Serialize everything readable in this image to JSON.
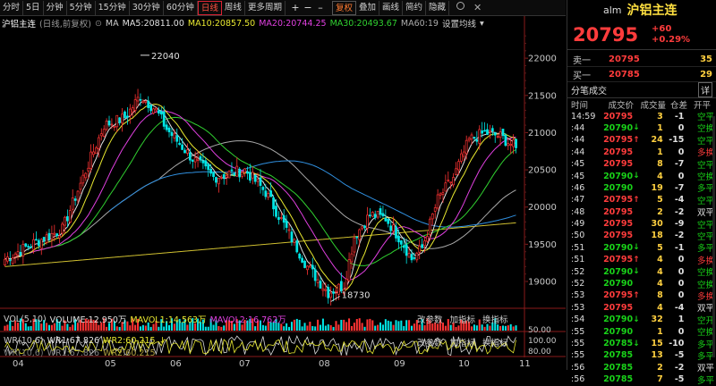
{
  "toolbar": {
    "periods": [
      "分时",
      "5日",
      "分钟",
      "5分钟",
      "15分钟",
      "30分钟",
      "60分钟",
      "日线",
      "周线",
      "更多周期"
    ],
    "active_period": "日线",
    "symbols": [
      "+",
      "−",
      "–"
    ],
    "right_btns": [
      "复权",
      "叠加",
      "画线",
      "简约",
      "隐藏"
    ],
    "active_right": "复权"
  },
  "info": {
    "name": "沪铝主连",
    "mode": "(日线,前复权)",
    "ma_label": "MA",
    "ma5": "MA5:20811.00",
    "ma10": "MA10:20857.50",
    "ma20": "MA20:20744.25",
    "ma30": "MA30:20493.67",
    "ma60": "MA60:19",
    "setting": "设置均线"
  },
  "chart_data": {
    "type": "candlestick",
    "ylim": [
      18700,
      22350
    ],
    "y_ticks": [
      22000,
      21500,
      21000,
      20500,
      20000,
      19500,
      19000
    ],
    "x_labels": [
      "04",
      "05",
      "06",
      "07",
      "08",
      "09",
      "10",
      "11"
    ],
    "high_label": "22040",
    "low_label": "18730",
    "colors": {
      "up": "#ff3333",
      "down": "#00e5e5",
      "ma5": "#e0e0e0",
      "ma10": "#e8e830",
      "ma20": "#e040e0",
      "ma30": "#30d030",
      "ma60": "#aaaaaa",
      "ma120": "#3090e0",
      "ma250": "#d0c030"
    }
  },
  "vol": {
    "label": "VOL(5,10)",
    "volume": "VOLUME:12.950万",
    "mavol1": "MAVOL1:14.563万",
    "mavol2": "MAVOL2:16.762万",
    "params": "改参数",
    "add": "加指标",
    "swap": "换指标",
    "axis": "50.00"
  },
  "wr1": {
    "label": "WR(10,6)",
    "wr1": "WR1:67.826",
    "wr2": "WR2:60.215",
    "axis_top": "100.00",
    "axis_bottom": "80.00"
  },
  "wr2": {
    "label": "WR(10,6)",
    "wr1": "WR1:67.826",
    "wr2": "WR2:60.215"
  },
  "panel": {
    "code": "alm",
    "name": "沪铝主连",
    "price": "20795",
    "change": "+60",
    "pct": "+0.29%",
    "ask_label": "卖一",
    "ask_price": "20795",
    "ask_vol": "35",
    "bid_label": "买一",
    "bid_price": "20785",
    "bid_vol": "29",
    "ticks_title": "分笔成交",
    "detail_btn": "详",
    "cols": [
      "时间",
      "成交价",
      "成交量",
      "仓差",
      "开平"
    ],
    "ticks": [
      {
        "t": "14:59",
        "p": "20795",
        "a": "",
        "q": "3",
        "o": "-1",
        "k": "空平",
        "pc": "red",
        "kc": "green"
      },
      {
        "t": ":44",
        "p": "20790",
        "a": "↓",
        "q": "1",
        "o": "0",
        "k": "空换",
        "pc": "green",
        "kc": "green"
      },
      {
        "t": ":44",
        "p": "20795",
        "a": "↑",
        "q": "24",
        "o": "-15",
        "k": "空平",
        "pc": "red",
        "kc": "green"
      },
      {
        "t": ":44",
        "p": "20795",
        "a": "",
        "q": "1",
        "o": "0",
        "k": "多换",
        "pc": "red",
        "kc": "red"
      },
      {
        "t": ":45",
        "p": "20795",
        "a": "",
        "q": "8",
        "o": "-7",
        "k": "空平",
        "pc": "red",
        "kc": "green"
      },
      {
        "t": ":45",
        "p": "20790",
        "a": "↓",
        "q": "4",
        "o": "0",
        "k": "空换",
        "pc": "green",
        "kc": "green"
      },
      {
        "t": ":46",
        "p": "20790",
        "a": "",
        "q": "19",
        "o": "-7",
        "k": "多平",
        "pc": "green",
        "kc": "green"
      },
      {
        "t": ":47",
        "p": "20795",
        "a": "↑",
        "q": "5",
        "o": "-4",
        "k": "空平",
        "pc": "red",
        "kc": "green"
      },
      {
        "t": ":48",
        "p": "20795",
        "a": "",
        "q": "2",
        "o": "-2",
        "k": "双平",
        "pc": "red",
        "kc": "white"
      },
      {
        "t": ":49",
        "p": "20795",
        "a": "",
        "q": "30",
        "o": "-9",
        "k": "空平",
        "pc": "red",
        "kc": "green"
      },
      {
        "t": ":50",
        "p": "20795",
        "a": "",
        "q": "18",
        "o": "-2",
        "k": "空平",
        "pc": "red",
        "kc": "green"
      },
      {
        "t": ":51",
        "p": "20790",
        "a": "↓",
        "q": "5",
        "o": "-1",
        "k": "多平",
        "pc": "green",
        "kc": "green"
      },
      {
        "t": ":51",
        "p": "20795",
        "a": "↑",
        "q": "4",
        "o": "0",
        "k": "多换",
        "pc": "red",
        "kc": "red"
      },
      {
        "t": ":52",
        "p": "20790",
        "a": "↓",
        "q": "4",
        "o": "0",
        "k": "空换",
        "pc": "green",
        "kc": "green"
      },
      {
        "t": ":52",
        "p": "20790",
        "a": "",
        "q": "4",
        "o": "0",
        "k": "空换",
        "pc": "green",
        "kc": "green"
      },
      {
        "t": ":53",
        "p": "20795",
        "a": "↑",
        "q": "8",
        "o": "0",
        "k": "多换",
        "pc": "red",
        "kc": "red"
      },
      {
        "t": ":53",
        "p": "20795",
        "a": "",
        "q": "4",
        "o": "-4",
        "k": "双平",
        "pc": "red",
        "kc": "white"
      },
      {
        "t": ":54",
        "p": "20790",
        "a": "↓",
        "q": "32",
        "o": "1",
        "k": "空开",
        "pc": "green",
        "kc": "green"
      },
      {
        "t": ":55",
        "p": "20790",
        "a": "",
        "q": "1",
        "o": "0",
        "k": "空换",
        "pc": "green",
        "kc": "green"
      },
      {
        "t": ":55",
        "p": "20785",
        "a": "↓",
        "q": "15",
        "o": "-10",
        "k": "多平",
        "pc": "green",
        "kc": "green"
      },
      {
        "t": ":55",
        "p": "20785",
        "a": "",
        "q": "13",
        "o": "-5",
        "k": "多平",
        "pc": "green",
        "kc": "green"
      },
      {
        "t": ":56",
        "p": "20785",
        "a": "",
        "q": "2",
        "o": "-2",
        "k": "双平",
        "pc": "green",
        "kc": "white"
      },
      {
        "t": ":56",
        "p": "20785",
        "a": "",
        "q": "7",
        "o": "-5",
        "k": "多平",
        "pc": "green",
        "kc": "green"
      }
    ]
  }
}
